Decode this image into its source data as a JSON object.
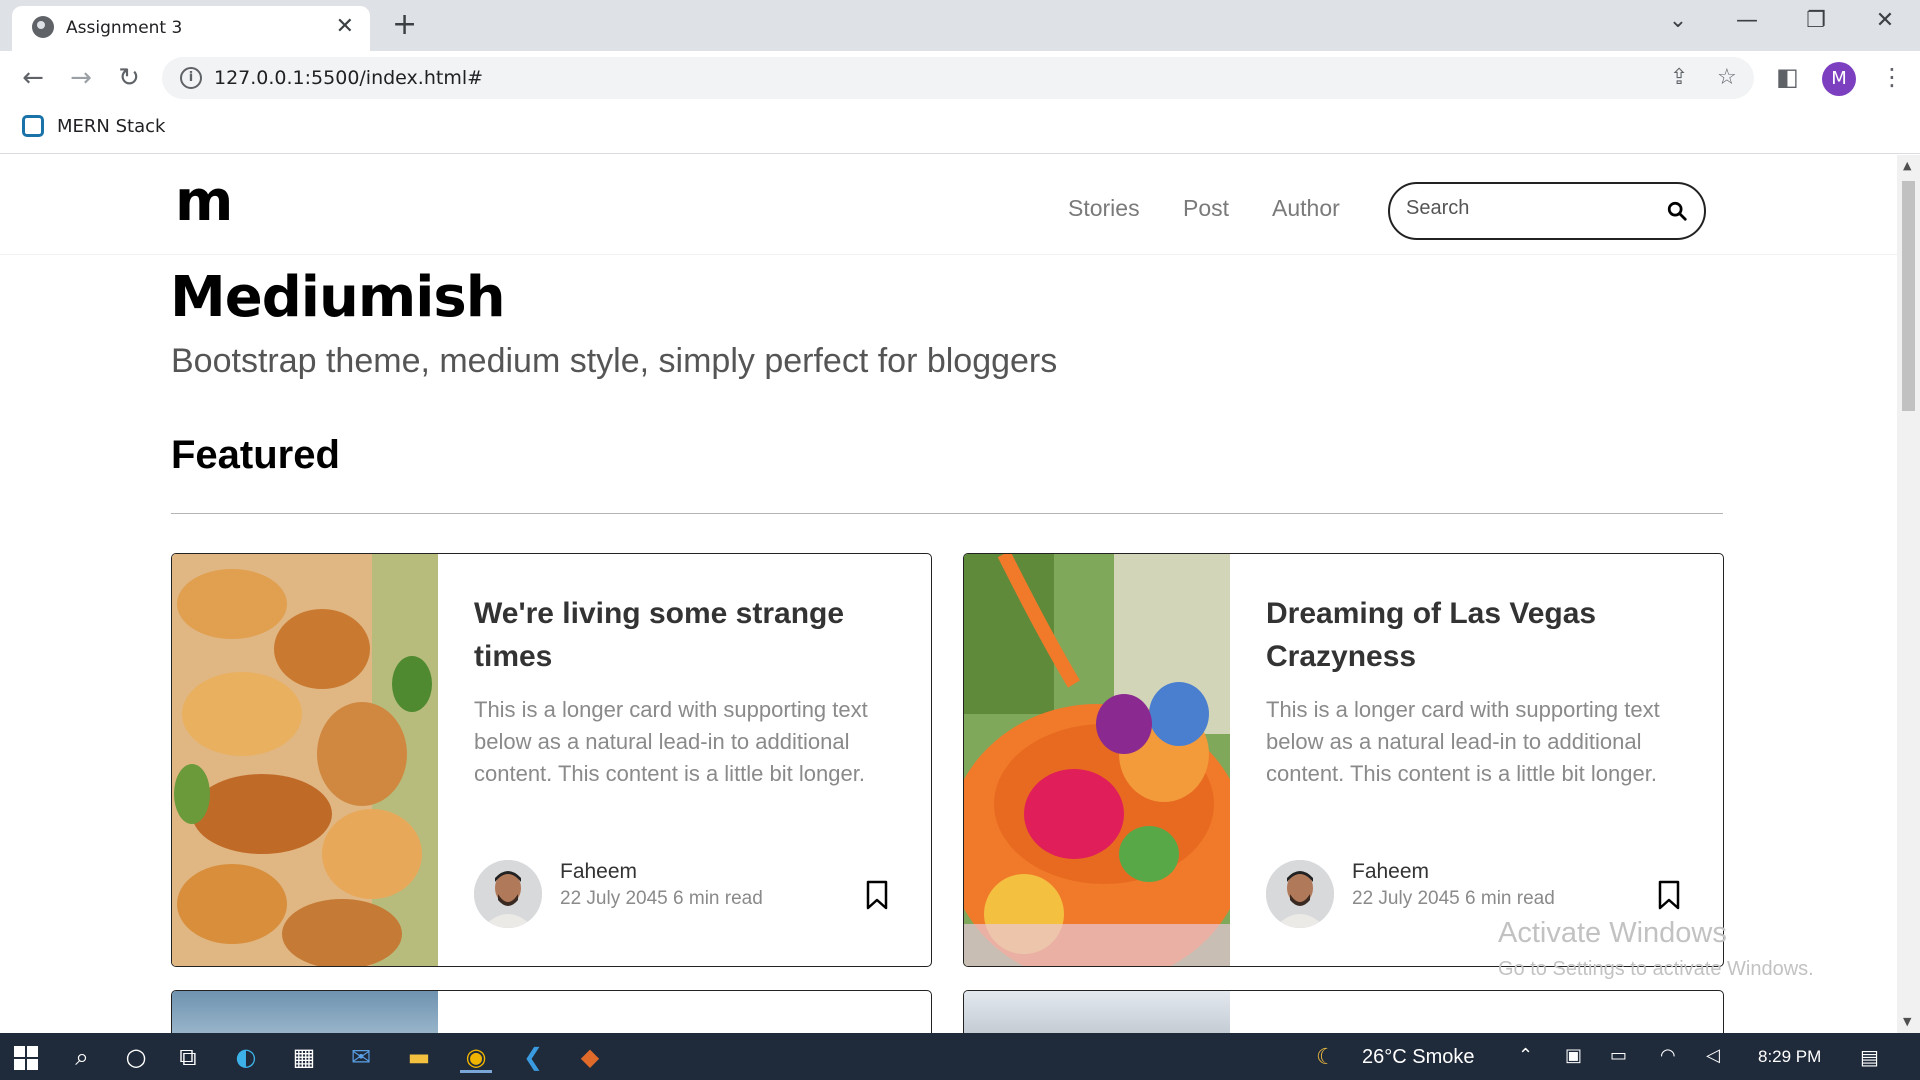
{
  "browser": {
    "tab_title": "Assignment 3",
    "tab_close": "✕",
    "new_tab": "+",
    "url": "127.0.0.1:5500/index.html#",
    "profile_initial": "M",
    "bookmark_label": "MERN Stack"
  },
  "site": {
    "logo": "m",
    "nav": [
      "Stories",
      "Post",
      "Author"
    ],
    "search_placeholder": "Search",
    "hero_title": "Mediumish",
    "hero_subtitle": "Bootstrap theme, medium style, simply perfect for bloggers",
    "section_title": "Featured",
    "cards": [
      {
        "title": "We're living some strange times",
        "text": "This is a longer card with supporting text below as a natural lead-in to additional content. This content is a little bit longer.",
        "author": "Faheem",
        "meta": "22 July 2045 6 min read"
      },
      {
        "title": "Dreaming of Las Vegas Crazyness",
        "text": "This is a longer card with supporting text below as a natural lead-in to additional content. This content is a little bit longer.",
        "author": "Faheem",
        "meta": "22 July 2045 6 min read"
      }
    ]
  },
  "watermark": {
    "line1": "Activate Windows",
    "line2": "Go to Settings to activate Windows."
  },
  "taskbar": {
    "weather": "26°C  Smoke",
    "time": "8:29 PM"
  }
}
